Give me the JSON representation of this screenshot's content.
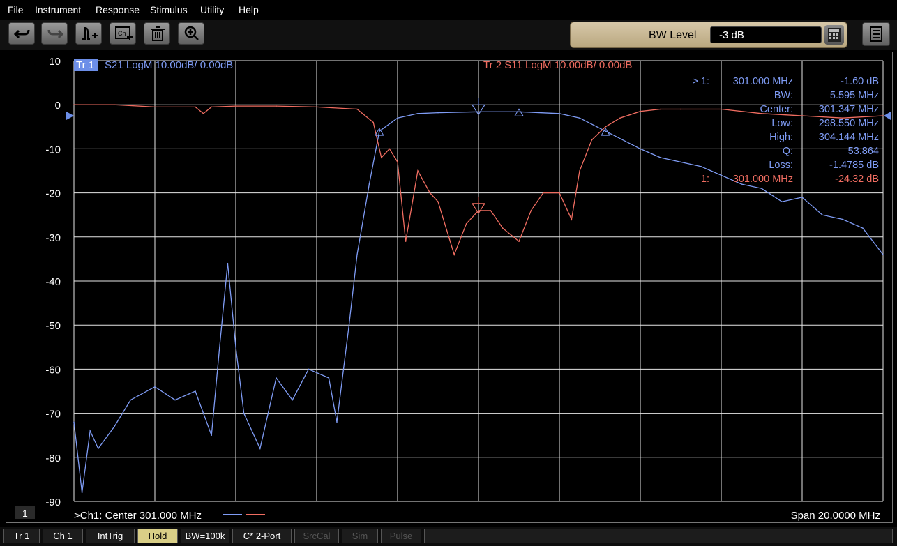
{
  "menu": [
    "File",
    "Instrument",
    "Response",
    "Stimulus",
    "Utility",
    "Help"
  ],
  "toolbar": {
    "buttons": [
      "undo-icon",
      "redo-icon",
      "add-marker-icon",
      "add-channel-icon",
      "delete-icon",
      "zoom-icon"
    ],
    "bw_label": "BW Level",
    "bw_value": "-3 dB"
  },
  "traces": {
    "tr1_badge": "Tr 1",
    "tr1_desc": "S21 LogM 10.00dB/  0.00dB",
    "tr2_desc": "Tr  2   S11 LogM 10.00dB/  0.00dB",
    "tr1_color": "#7f9cf5",
    "tr2_color": "#f06d61"
  },
  "markers": {
    "rows": [
      {
        "label": "> 1:",
        "freq": "301.000  MHz",
        "value": "-1.60 dB",
        "color": "blue"
      },
      {
        "label": "BW:",
        "freq": "",
        "value": "5.595 MHz",
        "color": "blue"
      },
      {
        "label": "Center:",
        "freq": "",
        "value": "301.347 MHz",
        "color": "blue"
      },
      {
        "label": "Low:",
        "freq": "",
        "value": "298.550 MHz",
        "color": "blue"
      },
      {
        "label": "High:",
        "freq": "",
        "value": "304.144 MHz",
        "color": "blue"
      },
      {
        "label": "Q:",
        "freq": "",
        "value": "53.864",
        "color": "blue"
      },
      {
        "label": "Loss:",
        "freq": "",
        "value": "-1.4785 dB",
        "color": "blue"
      },
      {
        "label": "1:",
        "freq": "301.000  MHz",
        "value": "-24.32 dB",
        "color": "red"
      }
    ]
  },
  "footer": {
    "channel_box": "1",
    "center": ">Ch1:  Center  301.000 MHz",
    "span": "Span  20.0000 MHz"
  },
  "status": [
    "Tr 1",
    "Ch 1",
    "IntTrig",
    "Hold",
    "BW=100k",
    "C* 2-Port",
    "SrcCal",
    "Sim",
    "Pulse"
  ],
  "chart_data": {
    "type": "line",
    "xlabel": "",
    "ylabel": "",
    "x_center_mhz": 301.0,
    "x_span_mhz": 20.0,
    "xlim": [
      291.0,
      311.0
    ],
    "ylim": [
      -95,
      15
    ],
    "y_ticks": [
      10,
      0,
      -10,
      -20,
      -30,
      -40,
      -50,
      -60,
      -70,
      -80,
      -90
    ],
    "grid": true,
    "series": [
      {
        "name": "S21",
        "x": [
          291.0,
          291.2,
          291.4,
          291.6,
          292.0,
          292.4,
          293.0,
          293.5,
          294.0,
          294.4,
          294.6,
          294.8,
          295.0,
          295.2,
          295.6,
          296.0,
          296.4,
          296.8,
          297.3,
          297.5,
          297.8,
          298.0,
          298.3,
          298.55,
          299.0,
          299.5,
          300.0,
          301.0,
          302.0,
          303.0,
          303.5,
          304.14,
          305.0,
          305.5,
          306.0,
          306.5,
          307.0,
          307.5,
          308.0,
          308.5,
          309.0,
          309.5,
          310.0,
          310.5,
          311.0
        ],
        "y": [
          -72,
          -88,
          -74,
          -78,
          -73,
          -67,
          -64,
          -67,
          -65,
          -75,
          -55,
          -36,
          -55,
          -70,
          -78,
          -62,
          -67,
          -60,
          -62,
          -72,
          -50,
          -34,
          -18,
          -6,
          -3,
          -2,
          -1.8,
          -1.6,
          -1.6,
          -2,
          -3,
          -6,
          -10,
          -12,
          -13,
          -14,
          -16,
          -18,
          -19,
          -22,
          -21,
          -25,
          -26,
          -28,
          -34
        ]
      },
      {
        "name": "S11",
        "x": [
          291.0,
          292.0,
          293.0,
          294.0,
          294.2,
          294.4,
          295.0,
          296.0,
          297.0,
          298.0,
          298.4,
          298.6,
          298.8,
          299.0,
          299.2,
          299.5,
          299.8,
          300.0,
          300.4,
          300.7,
          301.0,
          301.3,
          301.6,
          302.0,
          302.3,
          302.6,
          303.0,
          303.3,
          303.5,
          303.8,
          304.14,
          304.5,
          305.0,
          305.5,
          306.0,
          307.0,
          308.0,
          309.0,
          310.0,
          311.0
        ],
        "y": [
          0,
          0,
          -0.5,
          -0.5,
          -2,
          -0.5,
          -0.3,
          -0.3,
          -0.5,
          -1,
          -4,
          -12,
          -10,
          -13,
          -31,
          -15,
          -20,
          -22,
          -34,
          -27,
          -24,
          -24,
          -28,
          -31,
          -24,
          -20,
          -20,
          -26,
          -15,
          -8,
          -5,
          -3,
          -1.5,
          -1,
          -1,
          -1,
          -2,
          -2.5,
          -3,
          -2.5
        ]
      }
    ]
  }
}
